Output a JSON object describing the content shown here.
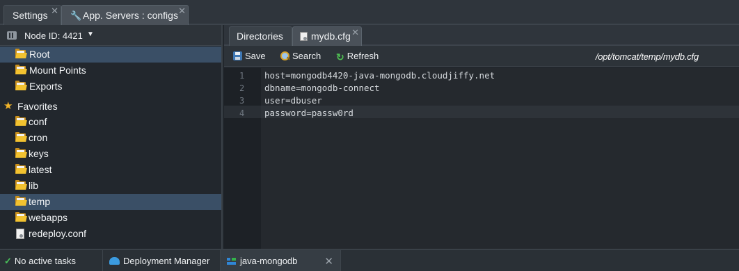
{
  "top_tabs": [
    {
      "label": "Settings",
      "close": "✕"
    },
    {
      "label": "App. Servers : configs",
      "close": "✕",
      "icon": "wrench-icon"
    }
  ],
  "node": {
    "label": "Node ID: 4421",
    "caret": "▼"
  },
  "tree": {
    "root": "Root",
    "mount_points": "Mount Points",
    "exports": "Exports",
    "favorites_label": "Favorites",
    "favorites": [
      "conf",
      "cron",
      "keys",
      "latest",
      "lib",
      "temp",
      "webapps"
    ],
    "file": "redeploy.conf",
    "selected": [
      "Root",
      "temp"
    ]
  },
  "editor_tabs": [
    {
      "label": "Directories"
    },
    {
      "label": "mydb.cfg",
      "close": "✕"
    }
  ],
  "toolbar": {
    "save": "Save",
    "search": "Search",
    "refresh": "Refresh",
    "path": "/opt/tomcat/temp/mydb.cfg"
  },
  "code_lines": [
    {
      "num": "1",
      "text": "host=mongodb4420-java-mongodb.cloudjiffy.net"
    },
    {
      "num": "2",
      "text": "dbname=mongodb-connect"
    },
    {
      "num": "3",
      "text": "user=dbuser"
    },
    {
      "num": "4",
      "text": "password=passw0rd"
    }
  ],
  "taskbar": {
    "status": "No active tasks",
    "deployment_manager": "Deployment Manager",
    "env": "java-mongodb",
    "close": "✕"
  },
  "colors": {
    "selection": "#3a4f66",
    "folder": "#f2c230",
    "star": "#f3b52a",
    "refresh": "#4fbf52",
    "check": "#49c25a"
  }
}
